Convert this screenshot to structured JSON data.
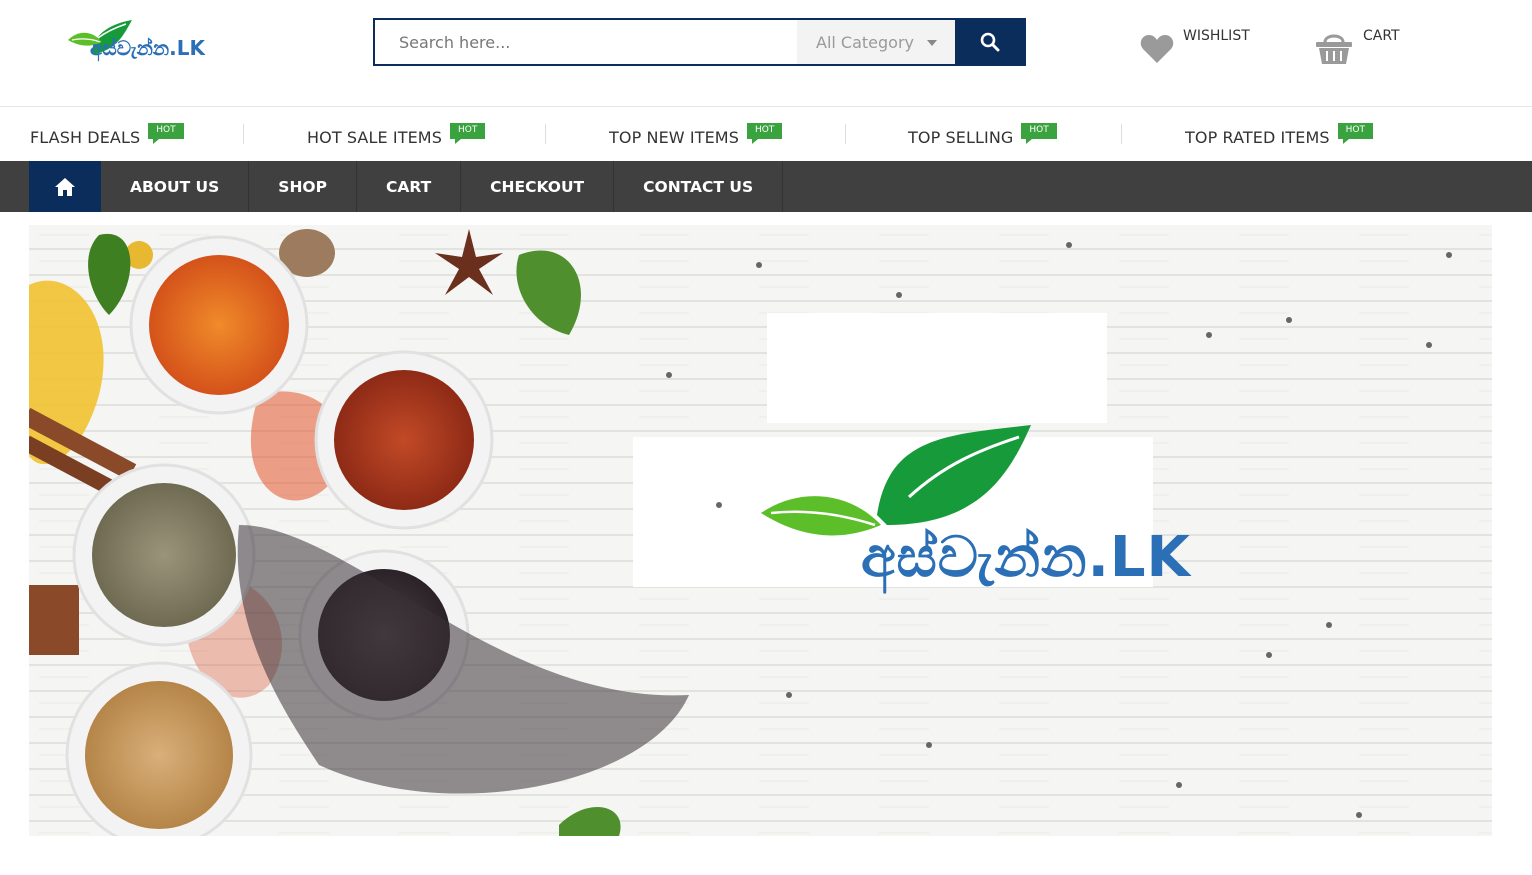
{
  "brand": {
    "logo_text": "අස්වැන්න.LK",
    "logo_suffix": ".LK",
    "colors": {
      "navy": "#0b2d5c",
      "nav_bg": "#404040",
      "hot_green": "#3aa33f",
      "leaf_dark": "#169a3a",
      "leaf_light": "#5cbf2a",
      "logo_blue": "#2b6fb6"
    }
  },
  "search": {
    "placeholder": "Search here...",
    "category": "All Category",
    "button_icon": "search-icon"
  },
  "header_links": {
    "wishlist": "WISHLIST",
    "cart": "CART"
  },
  "deals": [
    {
      "label": "FLASH DEALS",
      "badge": "HOT"
    },
    {
      "label": "HOT SALE ITEMS",
      "badge": "HOT"
    },
    {
      "label": "TOP NEW ITEMS",
      "badge": "HOT"
    },
    {
      "label": "TOP SELLING",
      "badge": "HOT"
    },
    {
      "label": "TOP RATED ITEMS",
      "badge": "HOT"
    }
  ],
  "nav": {
    "home_icon": "home-icon",
    "items": [
      "ABOUT US",
      "SHOP",
      "CART",
      "CHECKOUT",
      "CONTACT US"
    ]
  },
  "banner": {
    "logo_text": "අස්වැන්න.LK",
    "logo_suffix": ".LK"
  }
}
